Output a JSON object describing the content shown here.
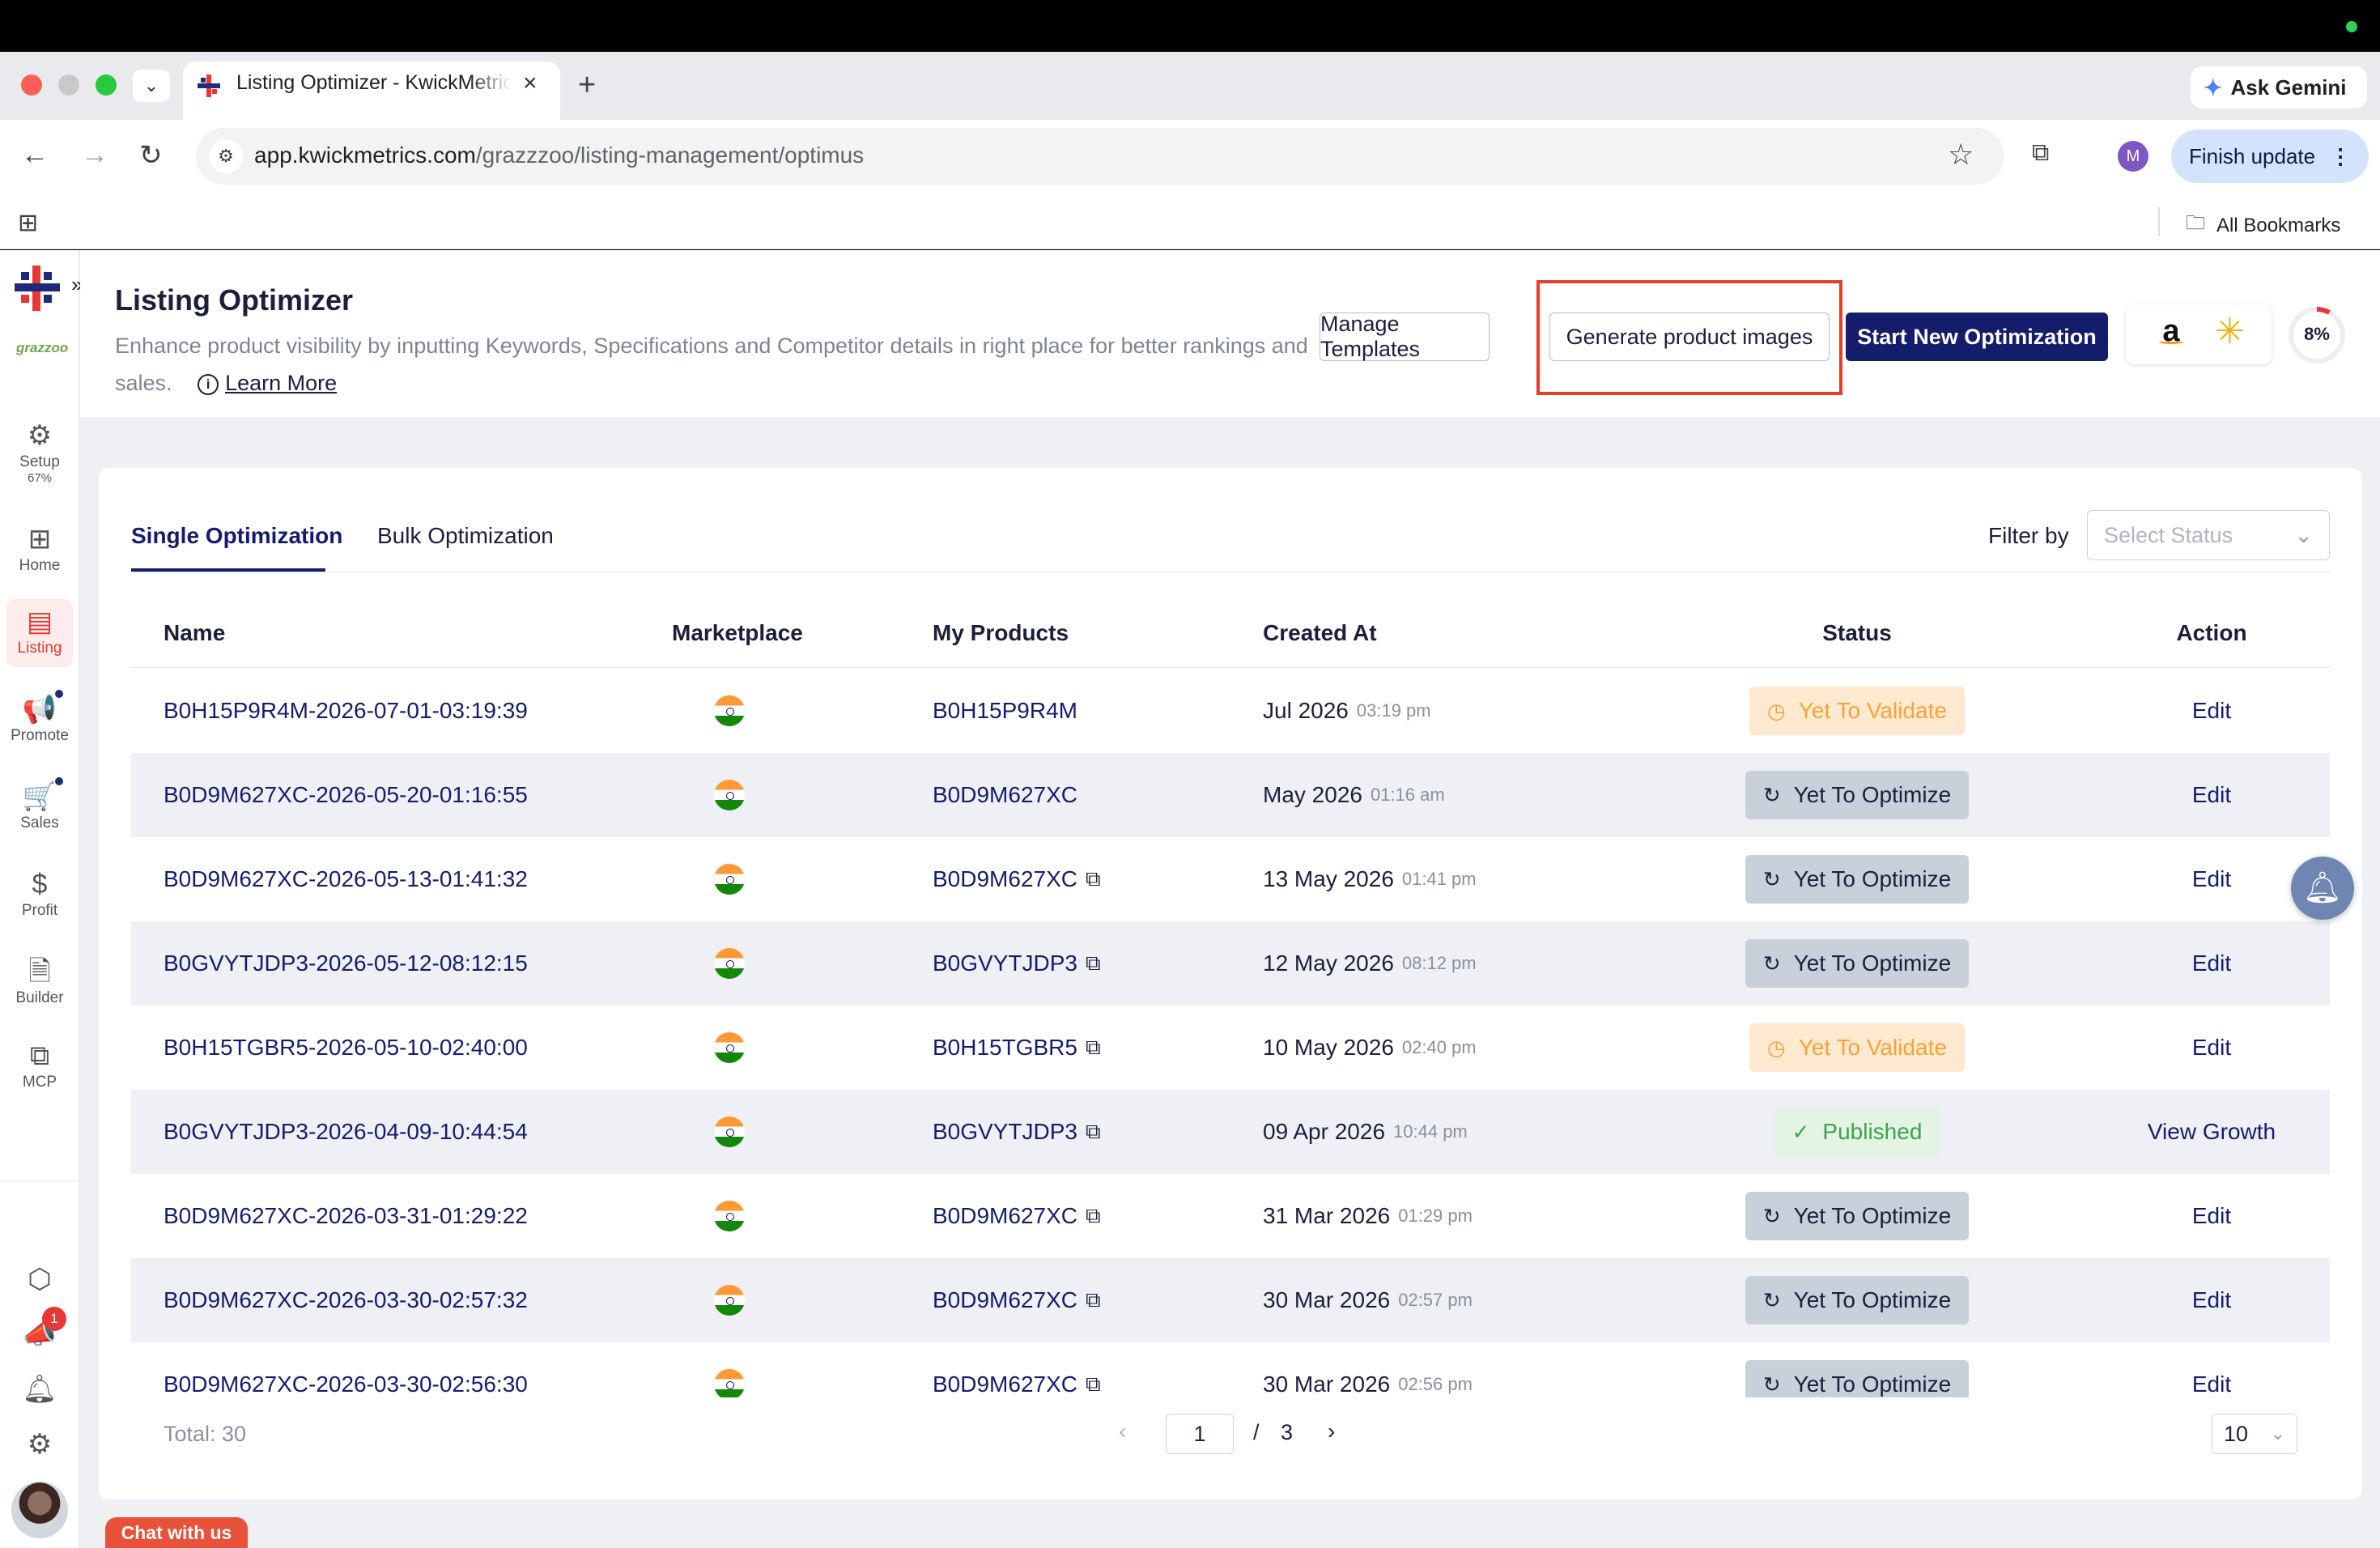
{
  "browser": {
    "tab_title": "Listing Optimizer - KwickMetrics",
    "new_tab_symbol": "+",
    "ask_gemini_label": "Ask Gemini",
    "url_domain": "app.kwickmetrics.com",
    "url_path": "/grazzzoo/listing-management/optimus",
    "finish_update_label": "Finish update",
    "profile_initial": "M",
    "all_bookmarks_label": "All Bookmarks"
  },
  "sidebar": {
    "brand_text": "grazzoo",
    "items": [
      {
        "label": "Setup",
        "sub": "67%",
        "icon": "gear-icon"
      },
      {
        "label": "Home",
        "icon": "grid-icon"
      },
      {
        "label": "Listing",
        "icon": "listing-icon"
      },
      {
        "label": "Promote",
        "icon": "megaphone-icon"
      },
      {
        "label": "Sales",
        "icon": "cart-icon"
      },
      {
        "label": "Profit",
        "icon": "dollar-icon"
      },
      {
        "label": "Builder",
        "icon": "document-icon"
      },
      {
        "label": "MCP",
        "icon": "mcp-icon"
      }
    ],
    "notification_count": "1"
  },
  "header": {
    "title": "Listing Optimizer",
    "description": "Enhance product visibility by inputting Keywords, Specifications and Competitor details in right place for better rankings and sales.",
    "learn_more": "Learn More",
    "manage_templates": "Manage Templates",
    "generate_images": "Generate product images",
    "start_optimization": "Start New Optimization",
    "progress_percent": "8%",
    "progress_value": 0.08,
    "highlight_color": "#e53e2b",
    "accent_color": "#141d6b"
  },
  "tabs": {
    "single": "Single Optimization",
    "bulk": "Bulk Optimization"
  },
  "filter": {
    "label": "Filter by",
    "placeholder": "Select Status"
  },
  "table": {
    "columns": [
      "Name",
      "Marketplace",
      "My Products",
      "Created At",
      "Status",
      "Action"
    ],
    "rows": [
      {
        "name": "B0H15P9R4M-2026-07-01-03:19:39",
        "product": "B0H15P9R4M",
        "date": "Jul 2026",
        "time": "03:19 pm",
        "status": "Yet To Validate",
        "status_type": "validate",
        "action": "Edit"
      },
      {
        "name": "B0D9M627XC-2026-05-20-01:16:55",
        "product": "B0D9M627XC",
        "date": "May 2026",
        "time": "01:16 am",
        "status": "Yet To Optimize",
        "status_type": "optimize",
        "action": "Edit"
      },
      {
        "name": "B0D9M627XC-2026-05-13-01:41:32",
        "product": "B0D9M627XC",
        "date": "13 May 2026",
        "time": "01:41 pm",
        "status": "Yet To Optimize",
        "status_type": "optimize",
        "action": "Edit"
      },
      {
        "name": "B0GVYTJDP3-2026-05-12-08:12:15",
        "product": "B0GVYTJDP3",
        "date": "12 May 2026",
        "time": "08:12 pm",
        "status": "Yet To Optimize",
        "status_type": "optimize",
        "action": "Edit"
      },
      {
        "name": "B0H15TGBR5-2026-05-10-02:40:00",
        "product": "B0H15TGBR5",
        "date": "10 May 2026",
        "time": "02:40 pm",
        "status": "Yet To Validate",
        "status_type": "validate",
        "action": "Edit"
      },
      {
        "name": "B0GVYTJDP3-2026-04-09-10:44:54",
        "product": "B0GVYTJDP3",
        "date": "09 Apr 2026",
        "time": "10:44 pm",
        "status": "Published",
        "status_type": "published",
        "action": "View Growth"
      },
      {
        "name": "B0D9M627XC-2026-03-31-01:29:22",
        "product": "B0D9M627XC",
        "date": "31 Mar 2026",
        "time": "01:29 pm",
        "status": "Yet To Optimize",
        "status_type": "optimize",
        "action": "Edit"
      },
      {
        "name": "B0D9M627XC-2026-03-30-02:57:32",
        "product": "B0D9M627XC",
        "date": "30 Mar 2026",
        "time": "02:57 pm",
        "status": "Yet To Optimize",
        "status_type": "optimize",
        "action": "Edit"
      },
      {
        "name": "B0D9M627XC-2026-03-30-02:56:30",
        "product": "B0D9M627XC",
        "date": "30 Mar 2026",
        "time": "02:56 pm",
        "status": "Yet To Optimize",
        "status_type": "optimize",
        "action": "Edit"
      }
    ]
  },
  "pagination": {
    "total": "Total: 30",
    "current_page": "1",
    "separator": "/",
    "total_pages": "3",
    "page_size": "10"
  },
  "chat_label": "Chat with us"
}
